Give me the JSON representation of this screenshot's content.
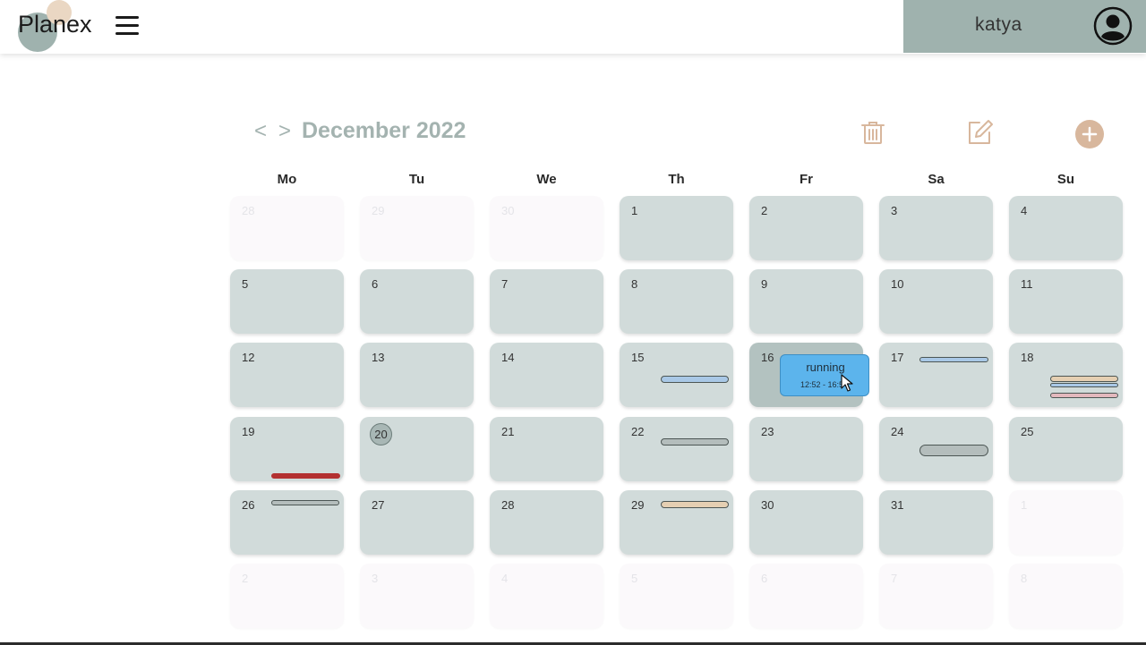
{
  "app": {
    "name": "Planex"
  },
  "user": {
    "name": "katya"
  },
  "calendar": {
    "title": "December 2022",
    "prev_label": "<",
    "next_label": ">",
    "weekdays": [
      "Mo",
      "Tu",
      "We",
      "Th",
      "Fr",
      "Sa",
      "Su"
    ],
    "weeks": [
      [
        {
          "d": "28",
          "other": true
        },
        {
          "d": "29",
          "other": true
        },
        {
          "d": "30",
          "other": true
        },
        {
          "d": "1"
        },
        {
          "d": "2"
        },
        {
          "d": "3"
        },
        {
          "d": "4"
        }
      ],
      [
        {
          "d": "5"
        },
        {
          "d": "6"
        },
        {
          "d": "7"
        },
        {
          "d": "8"
        },
        {
          "d": "9"
        },
        {
          "d": "10"
        },
        {
          "d": "11"
        }
      ],
      [
        {
          "d": "12"
        },
        {
          "d": "13"
        },
        {
          "d": "14"
        },
        {
          "d": "15"
        },
        {
          "d": "16",
          "highlight": true
        },
        {
          "d": "17"
        },
        {
          "d": "18"
        }
      ],
      [
        {
          "d": "19"
        },
        {
          "d": "20",
          "today": true
        },
        {
          "d": "21"
        },
        {
          "d": "22"
        },
        {
          "d": "23"
        },
        {
          "d": "24"
        },
        {
          "d": "25"
        }
      ],
      [
        {
          "d": "26"
        },
        {
          "d": "27"
        },
        {
          "d": "28"
        },
        {
          "d": "29"
        },
        {
          "d": "30"
        },
        {
          "d": "31"
        },
        {
          "d": "1",
          "other": true
        }
      ],
      [
        {
          "d": "2",
          "other": true
        },
        {
          "d": "3",
          "other": true
        },
        {
          "d": "4",
          "other": true
        },
        {
          "d": "5",
          "other": true
        },
        {
          "d": "6",
          "other": true
        },
        {
          "d": "7",
          "other": true
        },
        {
          "d": "8",
          "other": true
        }
      ]
    ]
  },
  "popup": {
    "title": "running",
    "time": "12:52 - 16:52"
  },
  "colors": {
    "accent": "#9fb2ae",
    "add_button": "#d8b79d",
    "cell": "#d1dbda",
    "event_blue": "#a9c8e6",
    "event_gray": "#b4bdbc",
    "event_beige": "#e5cfb2",
    "event_pink": "#e3b8bd",
    "event_red": "#b33030",
    "popup": "#5cb4ec"
  },
  "icons": [
    "menu-icon",
    "user-avatar-icon",
    "trash-icon",
    "edit-icon",
    "plus-icon",
    "mouse-cursor-icon"
  ]
}
